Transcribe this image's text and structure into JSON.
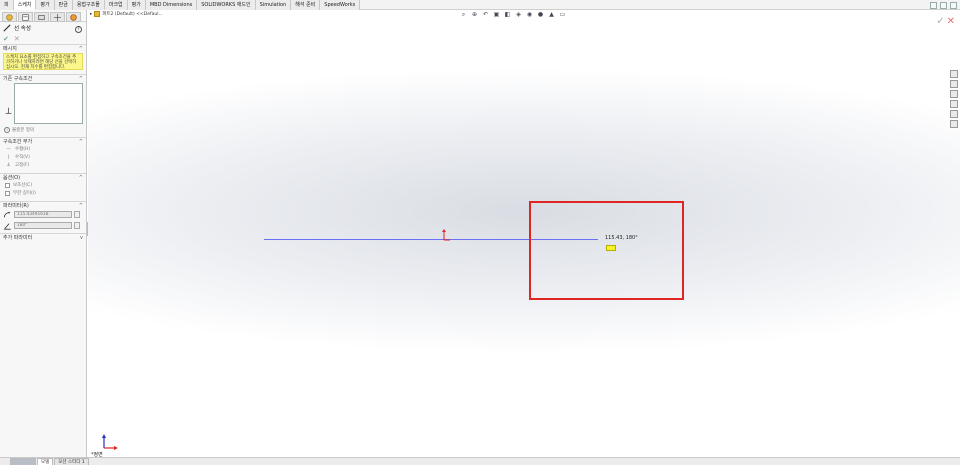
{
  "tabs": [
    "피",
    "스케치",
    "평가",
    "판금",
    "용접구조물",
    "마크업",
    "평가",
    "MBD Dimensions",
    "SOLIDWORKS 애드인",
    "Simulation",
    "해석 준비",
    "SpeedWorks"
  ],
  "active_tab_index": 1,
  "panel": {
    "title": "선 속성",
    "help": "?",
    "message_header": "메시지",
    "message_text": "스케치 요소를 편집하고 구속조건을 추가하거나 삭제하려면 해당 선을 선택하십시오. 현재 치수를 편집합니다.",
    "existing_relations_header": "기존 구속조건",
    "fix_status": "불충분 정의",
    "add_relations_header": "구속조건 부가",
    "relation_horizontal": "수평(H)",
    "relation_vertical": "수직(V)",
    "relation_fix": "고정(F)",
    "options_header": "옵션(O)",
    "option_construction": "보조선(C)",
    "option_infinite": "무한 길이(I)",
    "parameters_header": "파라미터(R)",
    "param_length": "115.43491618",
    "param_angle": "180°",
    "additional_params_header": "추가 파라미터"
  },
  "canvas": {
    "tree_crumb": "파트2 (Default) <<Defaul...",
    "dimension_label": "115.43, 180°",
    "view_name": "*정면"
  },
  "bottom_tabs": [
    "",
    "모델",
    "모션 스터디 1"
  ],
  "colors": {
    "sketch_line": "#6a6ff4",
    "highlight": "#e02525",
    "message_bg": "#fbf78a"
  },
  "icons": [
    "sketch-icon",
    "property-icon",
    "config-icon",
    "dimxpert-icon",
    "appearance-icon",
    "check-icon",
    "close-icon",
    "help-icon",
    "line-icon",
    "info-icon",
    "horizontal-icon",
    "vertical-icon",
    "fix-icon",
    "length-icon",
    "angle-icon",
    "search-icon",
    "zoom-icon",
    "view-orientation-icon",
    "display-style-icon",
    "hide-show-icon",
    "appearance-icon",
    "scene-icon",
    "monitor-icon"
  ]
}
